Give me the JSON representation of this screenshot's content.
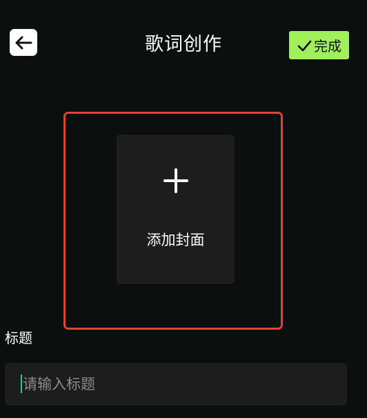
{
  "header": {
    "title": "歌词创作",
    "done_label": "完成",
    "back_icon": "arrow-left-icon",
    "done_icon": "check-icon"
  },
  "cover": {
    "label": "添加封面",
    "icon": "plus-icon"
  },
  "form": {
    "title_label": "标题",
    "title_placeholder": "请输入标题",
    "title_value": ""
  },
  "colors": {
    "background": "#0b0f0d",
    "done_button": "#9ff05a",
    "highlight_border": "#e5432f",
    "card": "#1c1d1c",
    "caret": "#2fc7a8"
  }
}
